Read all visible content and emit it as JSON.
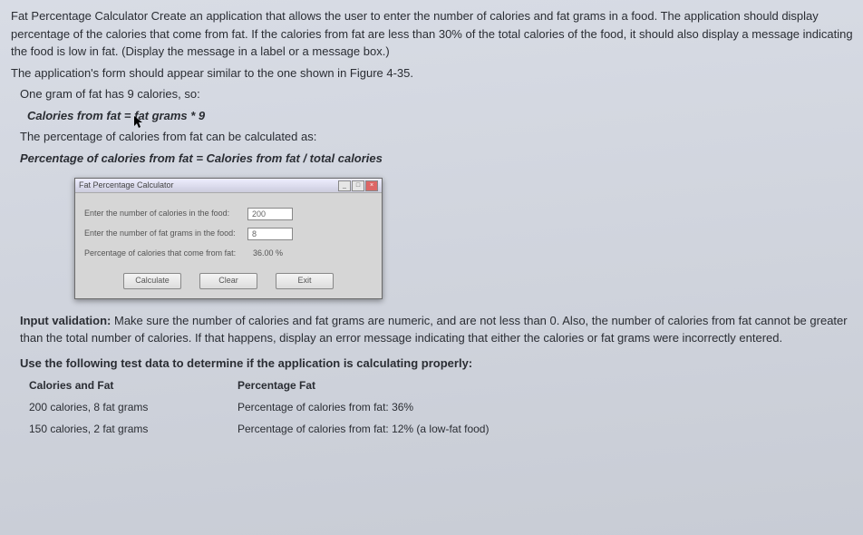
{
  "p1": "Fat Percentage Calculator Create an application that allows the user to enter the number of calories and fat grams in a food. The application should display percentage of the calories that come from fat. If the calories from fat are less than 30% of the total calories of the food, it should also display a message indicating the food is low in fat. (Display the message in a label or a message box.)",
  "p2": "The application's form should appear similar to the one shown in Figure 4-35.",
  "p3": "One gram of fat has 9 calories, so:",
  "formula1": "Calories from fat = fat grams * 9",
  "p4": "The percentage of calories from fat can be calculated as:",
  "formula2": "Percentage of calories from fat = Calories from fat / total calories",
  "window": {
    "title": "Fat Percentage Calculator",
    "label_cal": "Enter the number of calories in the food:",
    "val_cal": "200",
    "label_fat": "Enter the number of fat grams in the food:",
    "val_fat": "8",
    "label_pct": "Percentage of calories that come from fat:",
    "val_pct": "36.00 %",
    "btn_calc": "Calculate",
    "btn_clear": "Clear",
    "btn_exit": "Exit"
  },
  "validation_label": "Input validation:",
  "validation_text": " Make sure the number of calories and fat grams are numeric, and are not less than 0. Also, the number of calories from fat cannot be greater than the total number of calories. If that happens, display an error message indicating that either the calories or fat grams were incorrectly entered.",
  "test_intro": "Use the following test data to determine if the application is calculating properly:",
  "table": {
    "h1": "Calories and Fat",
    "h2": "Percentage Fat",
    "r1c1": "200 calories, 8 fat grams",
    "r1c2": "Percentage of calories from fat: 36%",
    "r2c1": "150 calories, 2 fat grams",
    "r2c2": "Percentage of calories from fat: 12% (a low-fat food)"
  }
}
